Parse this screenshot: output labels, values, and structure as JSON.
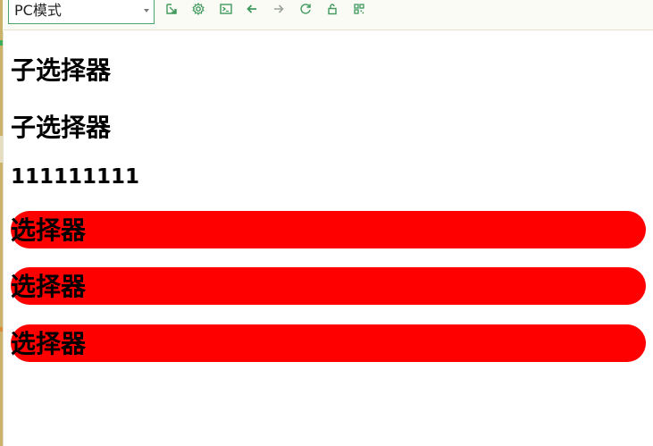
{
  "toolbar": {
    "mode_select": {
      "value": "PC模式"
    },
    "buttons": [
      {
        "icon": "open-external-icon"
      },
      {
        "icon": "gear-icon"
      },
      {
        "icon": "terminal-icon"
      },
      {
        "icon": "arrow-left-icon"
      },
      {
        "icon": "arrow-right-icon"
      },
      {
        "icon": "refresh-icon"
      },
      {
        "icon": "unlock-icon"
      },
      {
        "icon": "qr-code-icon"
      }
    ],
    "icon_color": "#3f9a5c"
  },
  "content": {
    "headings": [
      "子选择器",
      "子选择器",
      "111111111"
    ],
    "pills": [
      "选择器",
      "选择器",
      "选择器"
    ],
    "pill_color": "#ff0000"
  }
}
